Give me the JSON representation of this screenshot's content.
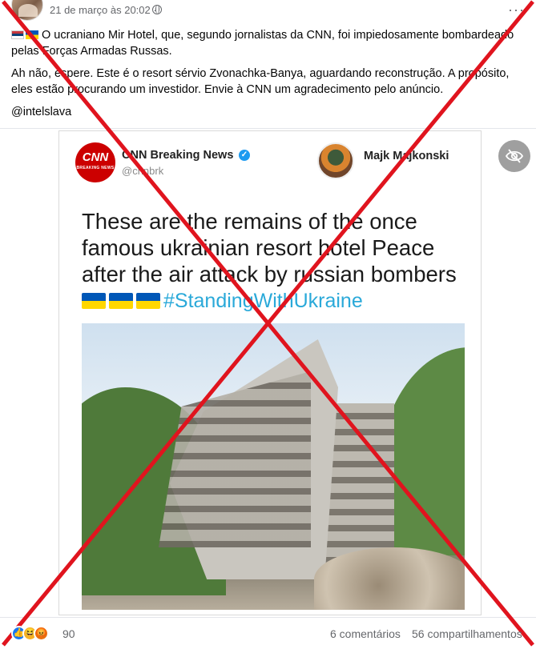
{
  "post": {
    "timestamp": "21 de março às 20:02 ·",
    "more_icon": "more-options-icon",
    "paragraph1": "O ucraniano Mir Hotel, que, segundo jornalistas da CNN, foi impiedosamente bombardeado pelas Forças Armadas Russas.",
    "paragraph2": "Ah não, espere. Este é o resort sérvio Zvonachka-Banya, aguardando reconstrução. A propósito, eles estão procurando um investidor. Envie à CNN um agradecimento pelo anúncio.",
    "paragraph3": "@intelslava"
  },
  "tweet": {
    "logo_text": "CNN",
    "logo_sub": "BREAKING NEWS",
    "account_name": "CNN Breaking News",
    "account_handle": "@cnnbrk",
    "retweeter_name": "Majk Majkonski",
    "headline": "These are the remains of the once famous ukrainian resort hotel Peace after the air attack by russian bombers",
    "hashtag": "#StandingWithUkraine"
  },
  "footer": {
    "reaction_count": "90",
    "comments": "6 comentários",
    "shares": "56 compartilhamentos"
  },
  "colors": {
    "cross": "#e0141e",
    "hashtag": "#2aa9d9",
    "cnn_red": "#cc0000"
  }
}
